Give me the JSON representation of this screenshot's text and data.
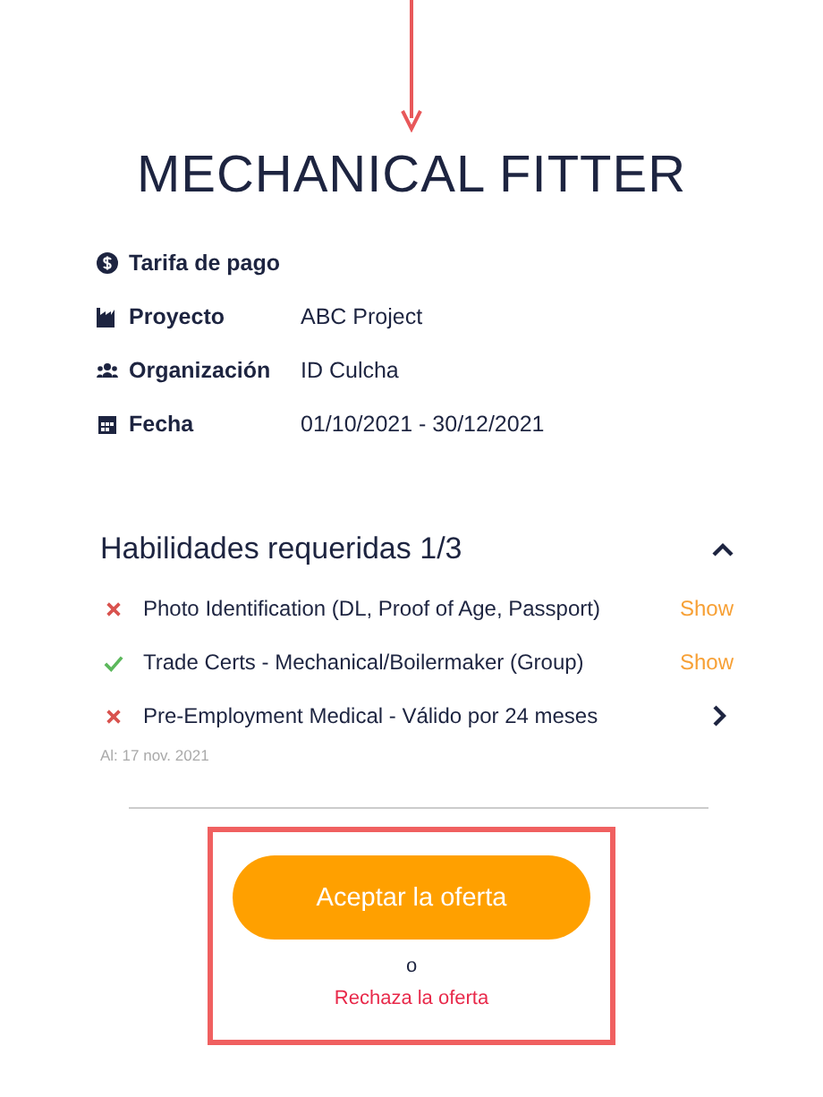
{
  "title": "MECHANICAL FITTER",
  "details": [
    {
      "kind": "pay",
      "label": "Tarifa de pago"
    },
    {
      "kind": "project",
      "label": "Proyecto",
      "value": "ABC Project"
    },
    {
      "kind": "organization",
      "label": "Organización",
      "value": "ID Culcha"
    },
    {
      "kind": "date",
      "label": "Fecha",
      "value": "01/10/2021 - 30/12/2021"
    }
  ],
  "skills": {
    "heading": "Habilidades requeridas 1/3",
    "expanded": true,
    "items": [
      {
        "name": "Photo Identification (DL, Proof of Age, Passport)",
        "met": false,
        "kind": "link",
        "action": "Show"
      },
      {
        "name": "Trade Certs - Mechanical/Boilermaker (Group)",
        "met": true,
        "kind": "link",
        "action": "Show"
      },
      {
        "name": "Pre-Employment Medical - Válido por 24 meses",
        "met": false,
        "kind": "arrow"
      }
    ],
    "note": "Al: 17 nov. 2021"
  },
  "accept_button": "Aceptar la oferta",
  "separator": "o",
  "reject_link": "Rechaza la oferta"
}
